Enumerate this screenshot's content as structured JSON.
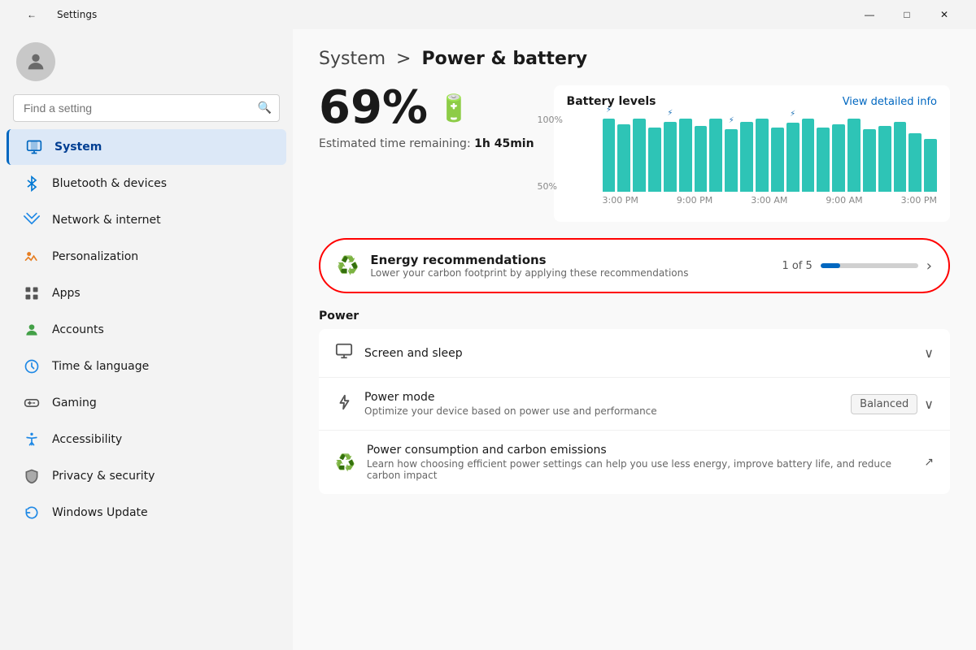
{
  "titleBar": {
    "title": "Settings",
    "backLabel": "←",
    "minLabel": "—",
    "maxLabel": "□",
    "closeLabel": "✕"
  },
  "sidebar": {
    "searchPlaceholder": "Find a setting",
    "navItems": [
      {
        "id": "system",
        "label": "System",
        "iconType": "system",
        "active": true
      },
      {
        "id": "bluetooth",
        "label": "Bluetooth & devices",
        "iconType": "bluetooth"
      },
      {
        "id": "network",
        "label": "Network & internet",
        "iconType": "network"
      },
      {
        "id": "personalization",
        "label": "Personalization",
        "iconType": "personalization"
      },
      {
        "id": "apps",
        "label": "Apps",
        "iconType": "apps"
      },
      {
        "id": "accounts",
        "label": "Accounts",
        "iconType": "accounts"
      },
      {
        "id": "time",
        "label": "Time & language",
        "iconType": "time"
      },
      {
        "id": "gaming",
        "label": "Gaming",
        "iconType": "gaming"
      },
      {
        "id": "accessibility",
        "label": "Accessibility",
        "iconType": "accessibility"
      },
      {
        "id": "privacy",
        "label": "Privacy & security",
        "iconType": "privacy"
      },
      {
        "id": "update",
        "label": "Windows Update",
        "iconType": "update"
      }
    ]
  },
  "main": {
    "breadcrumb": {
      "parent": "System",
      "separator": ">",
      "current": "Power & battery"
    },
    "battery": {
      "percent": "69%",
      "estimatedLabel": "Estimated time remaining:",
      "estimatedTime": "1h 45min"
    },
    "chart": {
      "title": "Battery levels",
      "viewDetailedLink": "View detailed info",
      "yLabels": [
        "100%",
        "50%"
      ],
      "xLabels": [
        "3:00 PM",
        "9:00 PM",
        "3:00 AM",
        "9:00 AM",
        "3:00 PM"
      ],
      "bars": [
        100,
        92,
        100,
        88,
        95,
        100,
        90,
        100,
        85,
        95,
        100,
        88,
        94,
        100,
        88,
        92,
        100,
        85,
        90,
        95,
        80,
        72
      ]
    },
    "energyRec": {
      "title": "Energy recommendations",
      "subtitle": "Lower your carbon footprint by applying these recommendations",
      "progressLabel": "1 of 5",
      "progressPercent": 20
    },
    "powerSection": {
      "label": "Power",
      "rows": [
        {
          "id": "screen-sleep",
          "title": "Screen and sleep",
          "subtitle": "",
          "rightType": "chevron-down"
        },
        {
          "id": "power-mode",
          "title": "Power mode",
          "subtitle": "Optimize your device based on power use and performance",
          "rightType": "dropdown",
          "dropdownValue": "Balanced"
        },
        {
          "id": "carbon",
          "title": "Power consumption and carbon emissions",
          "subtitle": "Learn how choosing efficient power settings can help you use less energy, improve battery life, and reduce carbon impact",
          "rightType": "external"
        }
      ]
    }
  }
}
